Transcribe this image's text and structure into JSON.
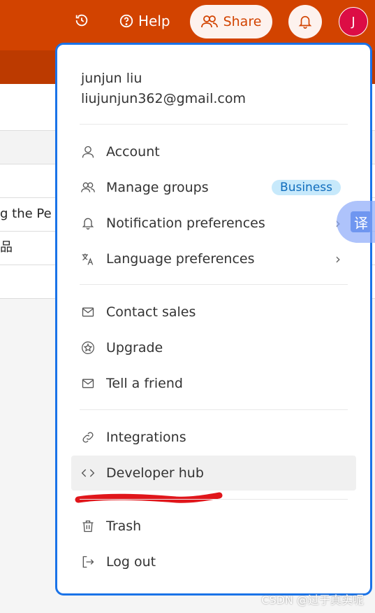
{
  "header": {
    "help_label": "Help",
    "share_label": "Share",
    "avatar_initial": "J",
    "colors": {
      "brand": "#d24300",
      "avatar": "#dc0d45"
    }
  },
  "background_rows": [
    "g the Pe",
    "品"
  ],
  "menu": {
    "user_name": "junjun liu",
    "user_email": "liujunjun362@gmail.com",
    "items": [
      {
        "label": "Account",
        "icon": "person-icon"
      },
      {
        "label": "Manage groups",
        "icon": "people-icon",
        "badge": "Business"
      },
      {
        "label": "Notification preferences",
        "icon": "bell-icon"
      },
      {
        "label": "Language preferences",
        "icon": "translate-icon"
      },
      {
        "label": "Contact sales",
        "icon": "mail-icon"
      },
      {
        "label": "Upgrade",
        "icon": "star-icon"
      },
      {
        "label": "Tell a friend",
        "icon": "mail-icon"
      },
      {
        "label": "Integrations",
        "icon": "link-icon"
      },
      {
        "label": "Developer hub",
        "icon": "code-icon"
      },
      {
        "label": "Trash",
        "icon": "trash-icon"
      },
      {
        "label": "Log out",
        "icon": "sign-out-icon"
      }
    ]
  },
  "translate_button": "译",
  "watermark": "CSDN @过于真实呢"
}
